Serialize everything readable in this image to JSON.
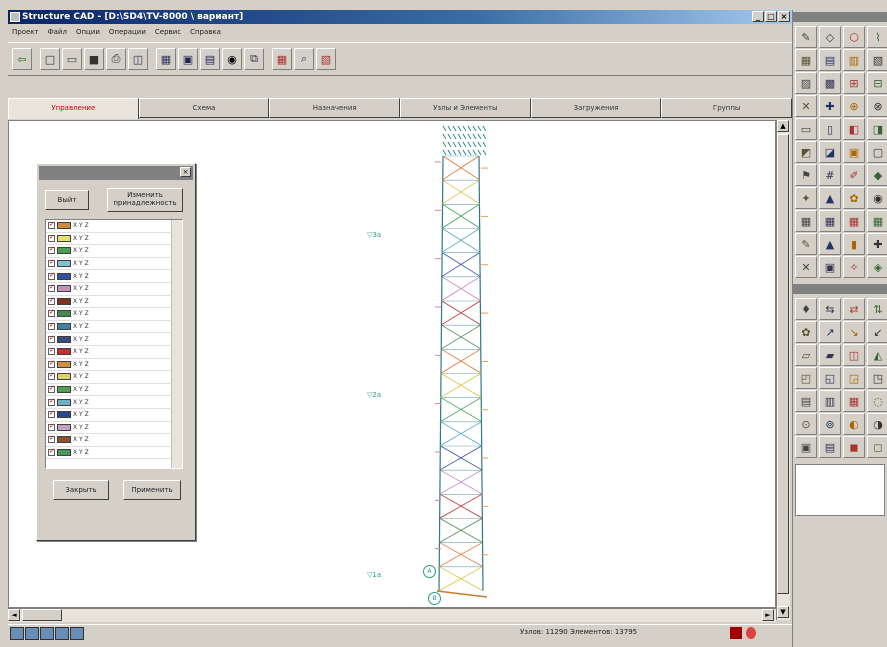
{
  "window": {
    "title": "Structure CAD - [D:\\SD4\\TV-8000 \\ вариант]",
    "controls": {
      "minimize": "_",
      "maximize": "□",
      "close": "×"
    }
  },
  "menu": [
    "Проект",
    "Файл",
    "Опции",
    "Операции",
    "Сервис",
    "Справка"
  ],
  "toolbar": {
    "icons": [
      "arrow-icon",
      "new-icon",
      "open-icon",
      "save-icon",
      "print-icon",
      "preview-icon",
      "mesh-icon",
      "grid-icon",
      "view-icon",
      "camera-icon",
      "copy-icon",
      "table-icon",
      "zoom-icon",
      "layers-icon"
    ]
  },
  "tabs": [
    {
      "label": "Управление",
      "active": true
    },
    {
      "label": "Схема",
      "active": false
    },
    {
      "label": "Назначения",
      "active": false
    },
    {
      "label": "Узлы и Элементы",
      "active": false
    },
    {
      "label": "Загружения",
      "active": false
    },
    {
      "label": "Группы",
      "active": false
    }
  ],
  "layer_panel": {
    "btn_exit": "Выйт",
    "btn_change": "Изменить принадлежность",
    "btn_close": "Закрыть",
    "btn_apply": "Применить",
    "close_glyph": "×",
    "rows": [
      {
        "label": "X Y Z",
        "color": "#d08a40"
      },
      {
        "label": "X Y Z",
        "color": "#e6e070"
      },
      {
        "label": "X Y Z",
        "color": "#4aa050"
      },
      {
        "label": "X Y Z",
        "color": "#80c0d0"
      },
      {
        "label": "X Y Z",
        "color": "#3050a0"
      },
      {
        "label": "X Y Z",
        "color": "#c090c0"
      },
      {
        "label": "X Y Z",
        "color": "#803020"
      },
      {
        "label": "X Y Z",
        "color": "#4a8a50"
      },
      {
        "label": "X Y Z",
        "color": "#4080a0"
      },
      {
        "label": "X Y Z",
        "color": "#3a4a7a"
      },
      {
        "label": "X Y Z",
        "color": "#c03030"
      },
      {
        "label": "X Y Z",
        "color": "#d09040"
      },
      {
        "label": "X Y Z",
        "color": "#e0d070"
      },
      {
        "label": "X Y Z",
        "color": "#50a050"
      },
      {
        "label": "X Y Z",
        "color": "#70b0c0"
      },
      {
        "label": "X Y Z",
        "color": "#2a4a90"
      },
      {
        "label": "X Y Z",
        "color": "#c0a0c0"
      },
      {
        "label": "X Y Z",
        "color": "#905030"
      },
      {
        "label": "X Y Z",
        "color": "#4a9a60"
      }
    ]
  },
  "canvas": {
    "level_labels": [
      "▽3а",
      "▽2а",
      "▽1а"
    ],
    "node_markers": [
      "A",
      "B"
    ]
  },
  "statusbar": {
    "text": "Узлов: 11290  Элементов: 13795"
  },
  "palette": {
    "top_icons": [
      "✎",
      "◇",
      "⬡",
      "⌇",
      "▦",
      "▤",
      "▥",
      "▧",
      "▨",
      "▩",
      "⊞",
      "⊟",
      "✕",
      "✚",
      "⊕",
      "⊗",
      "▭",
      "▯",
      "◧",
      "◨",
      "◩",
      "◪",
      "▣",
      "▢",
      "⚑",
      "#",
      "✐",
      "◆",
      "✦",
      "▲",
      "✿",
      "◉",
      "▦",
      "▦",
      "▦",
      "▦",
      "✎",
      "▲",
      "▮",
      "✚",
      "✕",
      "▣",
      "✧",
      "◈"
    ],
    "bottom_icons": [
      "♦",
      "⇆",
      "⇄",
      "⇅",
      "✿",
      "↗",
      "↘",
      "↙",
      "▱",
      "▰",
      "◫",
      "◭",
      "◰",
      "◱",
      "◲",
      "◳",
      "▤",
      "▥",
      "▦",
      "◌",
      "⊙",
      "⊚",
      "◐",
      "◑",
      "▣",
      "▤",
      "◼",
      "◻"
    ]
  }
}
